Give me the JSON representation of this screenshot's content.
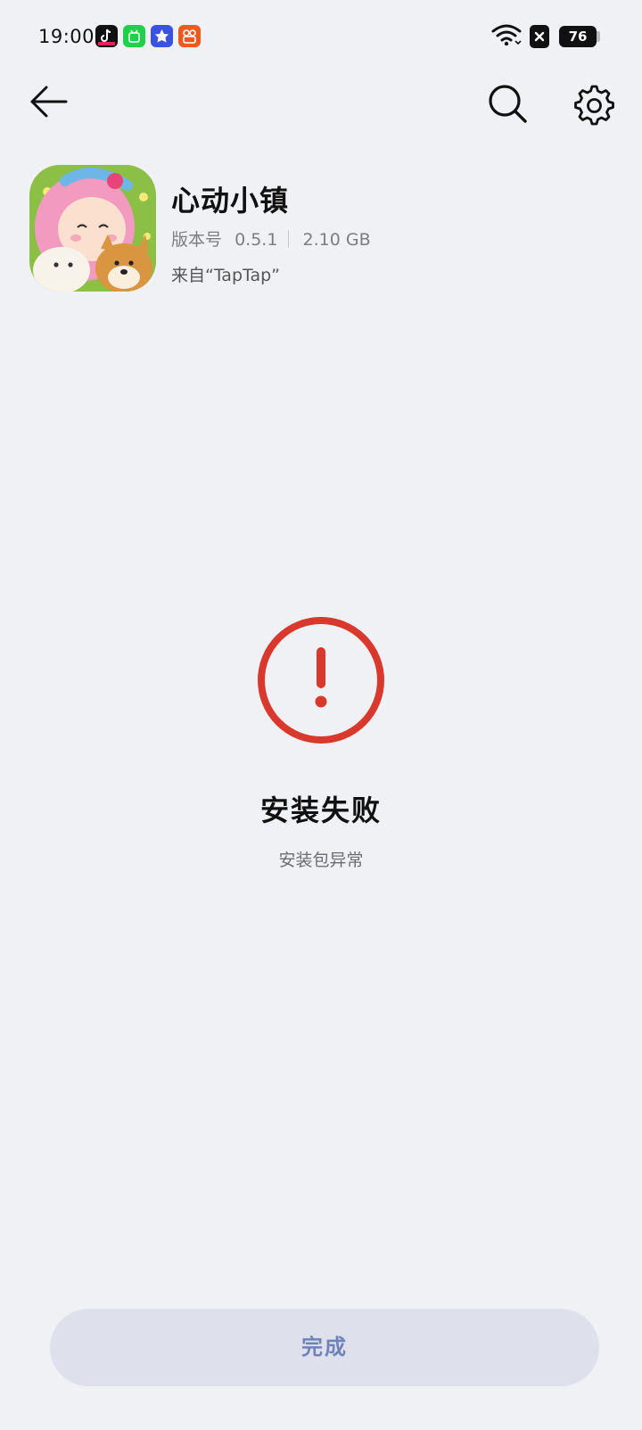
{
  "status_bar": {
    "time": "19:00",
    "notification_icons": [
      "douyin-icon",
      "iqiyi-icon",
      "app-store-icon",
      "kuaishou-icon"
    ],
    "battery_level": "76"
  },
  "nav": {
    "back_icon": "back-arrow-icon",
    "search_icon": "search-icon",
    "settings_icon": "gear-icon"
  },
  "app": {
    "name": "心动小镇",
    "version_label": "版本号",
    "version": "0.5.1",
    "size": "2.10 GB",
    "source": "来自“TapTap”"
  },
  "result": {
    "status_color": "#d9382c",
    "title": "安装失败",
    "description": "安装包异常"
  },
  "actions": {
    "done_label": "完成"
  }
}
